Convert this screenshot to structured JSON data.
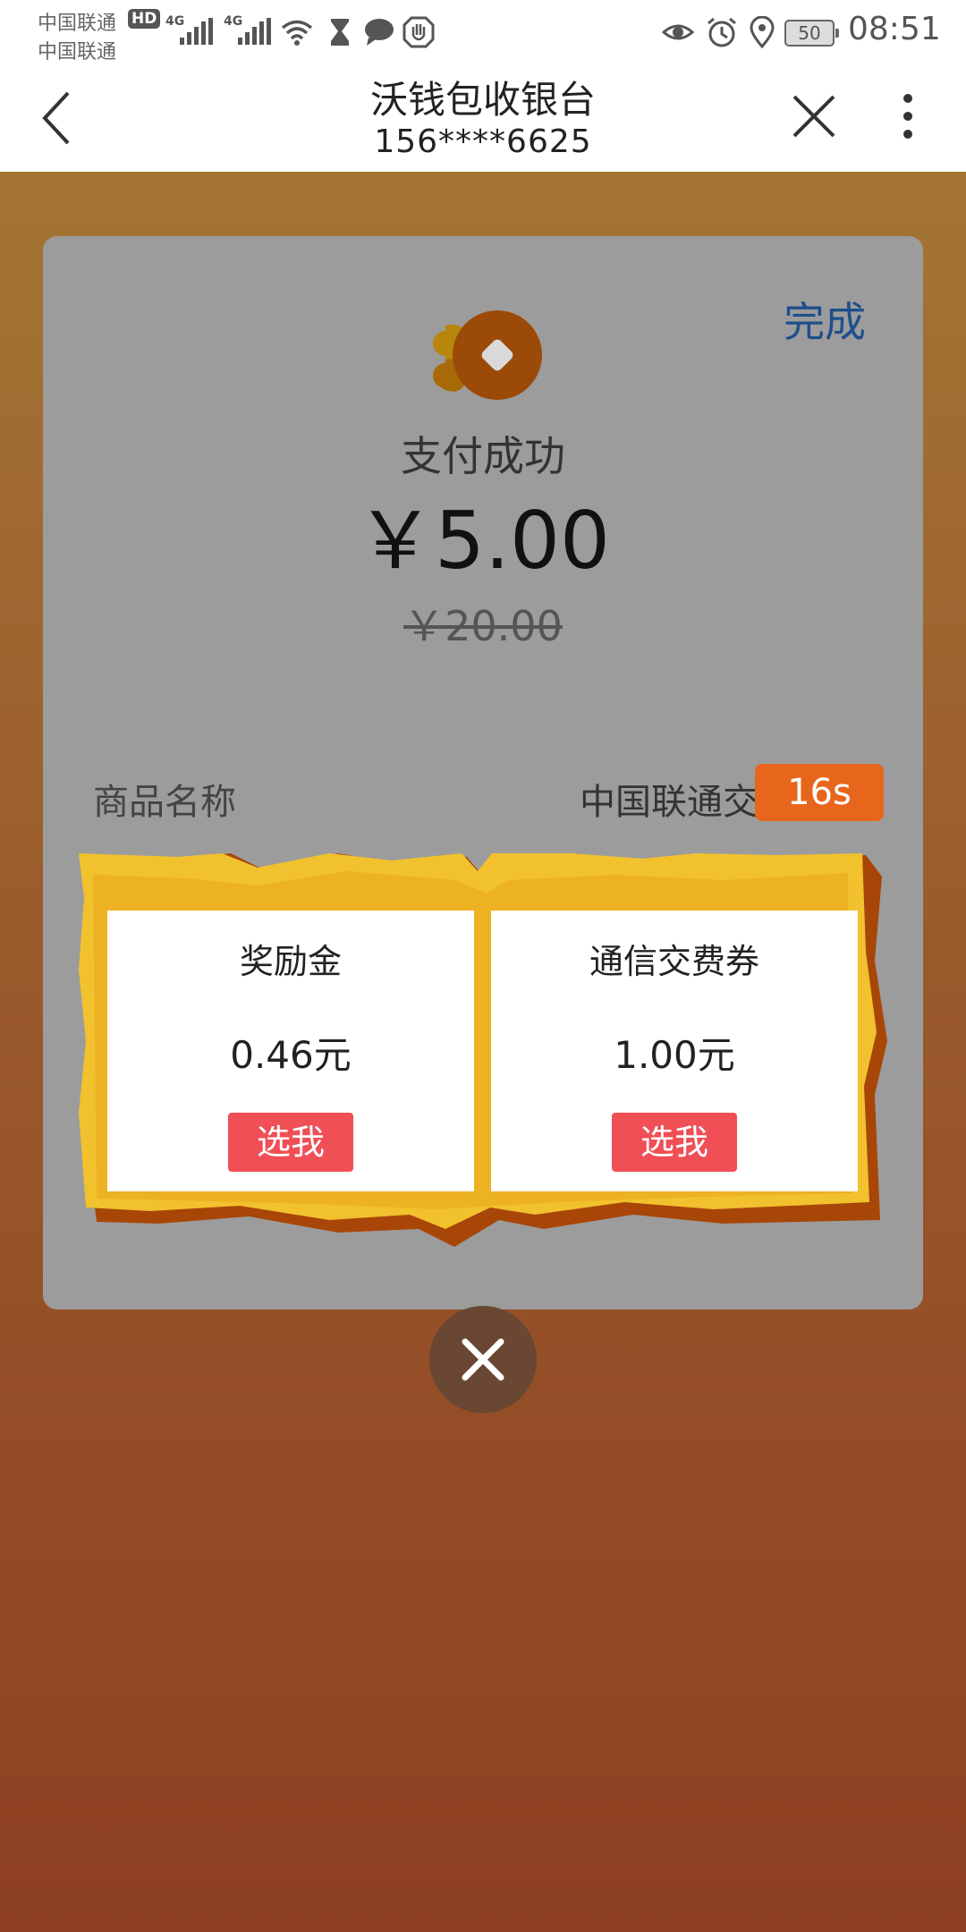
{
  "status_bar": {
    "carrier_1": "中国联通",
    "carrier_2": "中国联通",
    "hd_badge": "HD",
    "network_1": "4G",
    "network_2": "4G",
    "battery": "50",
    "time": "08:51"
  },
  "title_bar": {
    "title": "沃钱包收银台",
    "subtitle": "156****6625"
  },
  "receipt": {
    "done_label": "完成",
    "status": "支付成功",
    "amount": "￥5.00",
    "original_amount": "￥20.00",
    "product_label": "商品名称",
    "product_value": "中国联通交",
    "countdown": "16s"
  },
  "reward_popup": {
    "offers": [
      {
        "name": "奖励金",
        "value": "0.46元",
        "button": "选我"
      },
      {
        "name": "通信交费券",
        "value": "1.00元",
        "button": "选我"
      }
    ]
  },
  "colors": {
    "accent_link": "#1f4e8c",
    "timer_badge": "#e8661c",
    "pick_button": "#f04f55",
    "popup_gold": "#f2c12e"
  }
}
